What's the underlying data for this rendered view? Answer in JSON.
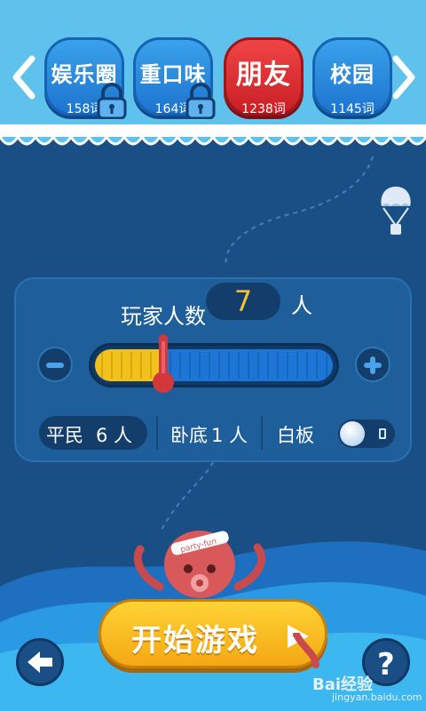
{
  "categories": [
    {
      "name": "娱乐圈",
      "count": "158词",
      "locked": true,
      "active": false
    },
    {
      "name": "重口味",
      "count": "164词",
      "locked": true,
      "active": false
    },
    {
      "name": "朋友",
      "count": "1238词",
      "locked": false,
      "active": true
    },
    {
      "name": "校园",
      "count": "1145词",
      "locked": false,
      "active": false
    }
  ],
  "players": {
    "label": "玩家人数",
    "count": "7",
    "unit": "人",
    "slider_fraction": 0.3
  },
  "roles": {
    "civilian_label": "平民",
    "civilian_count": "6 人",
    "undercover_label": "卧底",
    "undercover_count": "1 人",
    "blank_label": "白板",
    "blank_enabled": false
  },
  "mascot_text": "party-fun",
  "start_button": {
    "label": "开始游戏"
  },
  "help_icon": "?",
  "watermark": {
    "logo": "Bai经验",
    "url": "jingyan.baidu.com"
  },
  "colors": {
    "sky": "#5ec2ec",
    "deep_sea": "#1a4f86",
    "active_category": "#e0343a",
    "category": "#2386de",
    "slider_fill": "#f2c21c",
    "count_value": "#f5c22b",
    "start_button": "#f8bb22"
  },
  "icons": [
    "chevron-left-icon",
    "chevron-right-icon",
    "lock-icon",
    "balloon-icon",
    "minus-icon",
    "plus-icon",
    "thermometer-icon",
    "toggle-icon",
    "octopus-icon",
    "play-icon",
    "back-arrow-icon",
    "question-icon"
  ]
}
